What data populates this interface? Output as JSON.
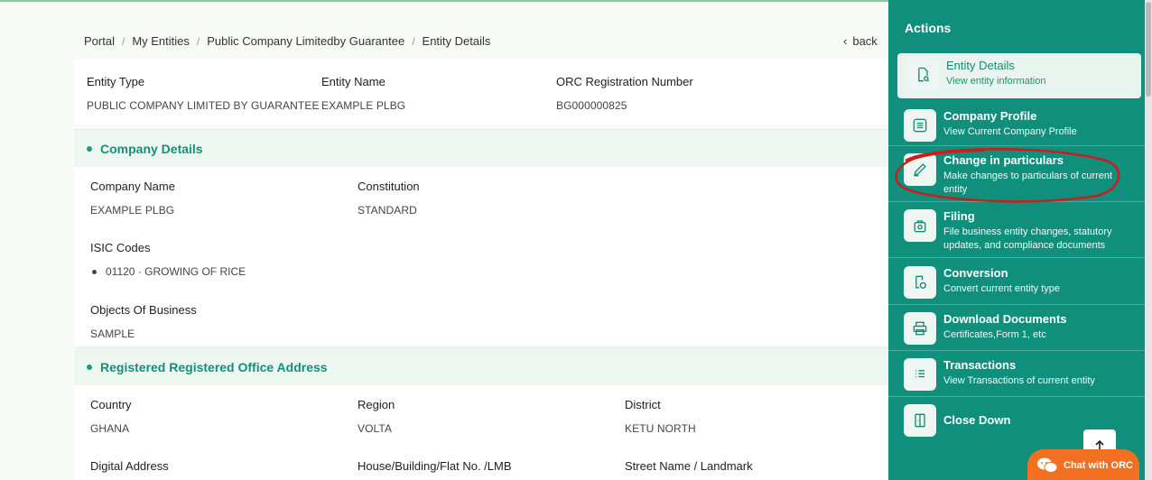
{
  "breadcrumb": [
    "Portal",
    "My Entities",
    "Public Company Limitedby Guarantee",
    "Entity Details"
  ],
  "back_label": "back",
  "entity": {
    "type_label": "Entity Type",
    "type_value": "PUBLIC COMPANY LIMITED BY GUARANTEE",
    "name_label": "Entity Name",
    "name_value": "EXAMPLE PLBG",
    "orc_label": "ORC Registration Number",
    "orc_value": "BG000000825"
  },
  "company_details": {
    "title": "Company Details",
    "company_name_label": "Company Name",
    "company_name_value": "EXAMPLE PLBG",
    "constitution_label": "Constitution",
    "constitution_value": "STANDARD",
    "isic_label": "ISIC Codes",
    "isic_items": [
      "01120 · GROWING OF RICE"
    ],
    "objects_label": "Objects Of Business",
    "objects_value": "SAMPLE"
  },
  "address": {
    "title": "Registered Registered Office Address",
    "country_label": "Country",
    "country_value": "GHANA",
    "region_label": "Region",
    "region_value": "VOLTA",
    "district_label": "District",
    "district_value": "KETU NORTH",
    "digital_label": "Digital Address",
    "house_label": "House/Building/Flat No. /LMB",
    "street_label": "Street Name / Landmark"
  },
  "sidebar": {
    "title": "Actions",
    "items": [
      {
        "title": "Entity Details",
        "subtitle": "View entity information",
        "icon": "document-search-icon"
      },
      {
        "title": "Company Profile",
        "subtitle": "View Current Company Profile",
        "icon": "list-card-icon"
      },
      {
        "title": "Change in particulars",
        "subtitle": "Make changes to particulars of current entity",
        "icon": "pencil-icon"
      },
      {
        "title": "Filing",
        "subtitle": "File business entity changes, statutory updates, and compliance documents",
        "icon": "dollar-bag-icon"
      },
      {
        "title": "Conversion",
        "subtitle": "Convert current entity type",
        "icon": "convert-icon"
      },
      {
        "title": "Download Documents",
        "subtitle": "Certificates,Form 1, etc",
        "icon": "printer-icon"
      },
      {
        "title": "Transactions",
        "subtitle": "View Transactions of current entity",
        "icon": "list-icon"
      },
      {
        "title": "Close Down",
        "subtitle": "",
        "icon": "exit-door-icon"
      }
    ]
  },
  "chat_label": "Chat with ORC",
  "colors": {
    "accent": "#0f8f7c",
    "section_text": "#158f78",
    "chat": "#f36f21",
    "annotation": "#d11a1a"
  }
}
